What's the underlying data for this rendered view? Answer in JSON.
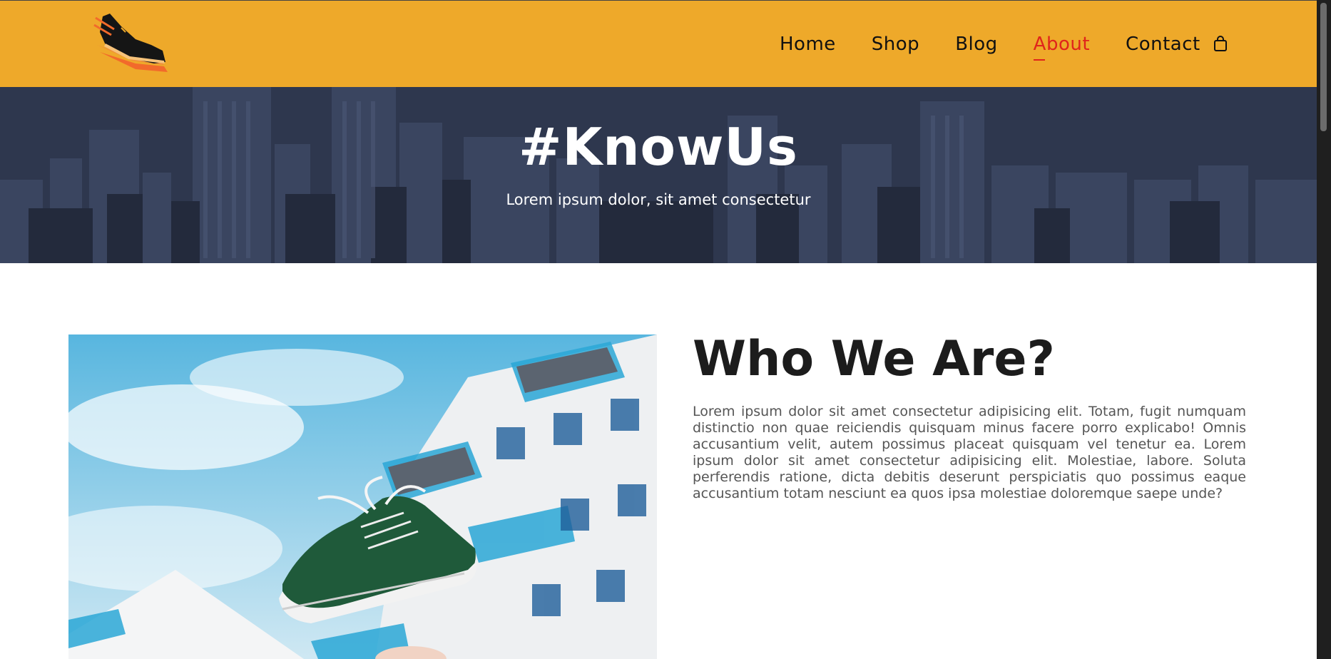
{
  "header": {
    "logo_name": "shoe-logo",
    "nav": [
      {
        "label": "Home",
        "active": false
      },
      {
        "label": "Shop",
        "active": false
      },
      {
        "label": "Blog",
        "active": false
      },
      {
        "label": "About",
        "active": true
      },
      {
        "label": "Contact",
        "active": false
      }
    ],
    "cart_icon": "shopping-bag-icon",
    "background": "#eea92a",
    "active_color": "#e0241b"
  },
  "hero": {
    "title": "#KnowUs",
    "subtitle": "Lorem ipsum dolor, sit amet consectetur",
    "background": "#2e374e"
  },
  "about": {
    "heading": "Who We Are?",
    "body": "Lorem ipsum dolor sit amet consectetur adipisicing elit. Totam, fugit numquam distinctio non quae reiciendis quisquam minus facere porro explicabo! Omnis accusantium velit, autem possimus placeat quisquam vel tenetur ea. Lorem ipsum dolor sit amet consectetur adipisicing elit. Molestiae, labore. Soluta perferendis ratione, dicta debitis deserunt perspiciatis quo possimus eaque accusantium totam nesciunt ea quos ipsa molestiae doloremque saepe unde?",
    "image": "floating-green-sneaker-in-front-of-building-photo"
  }
}
